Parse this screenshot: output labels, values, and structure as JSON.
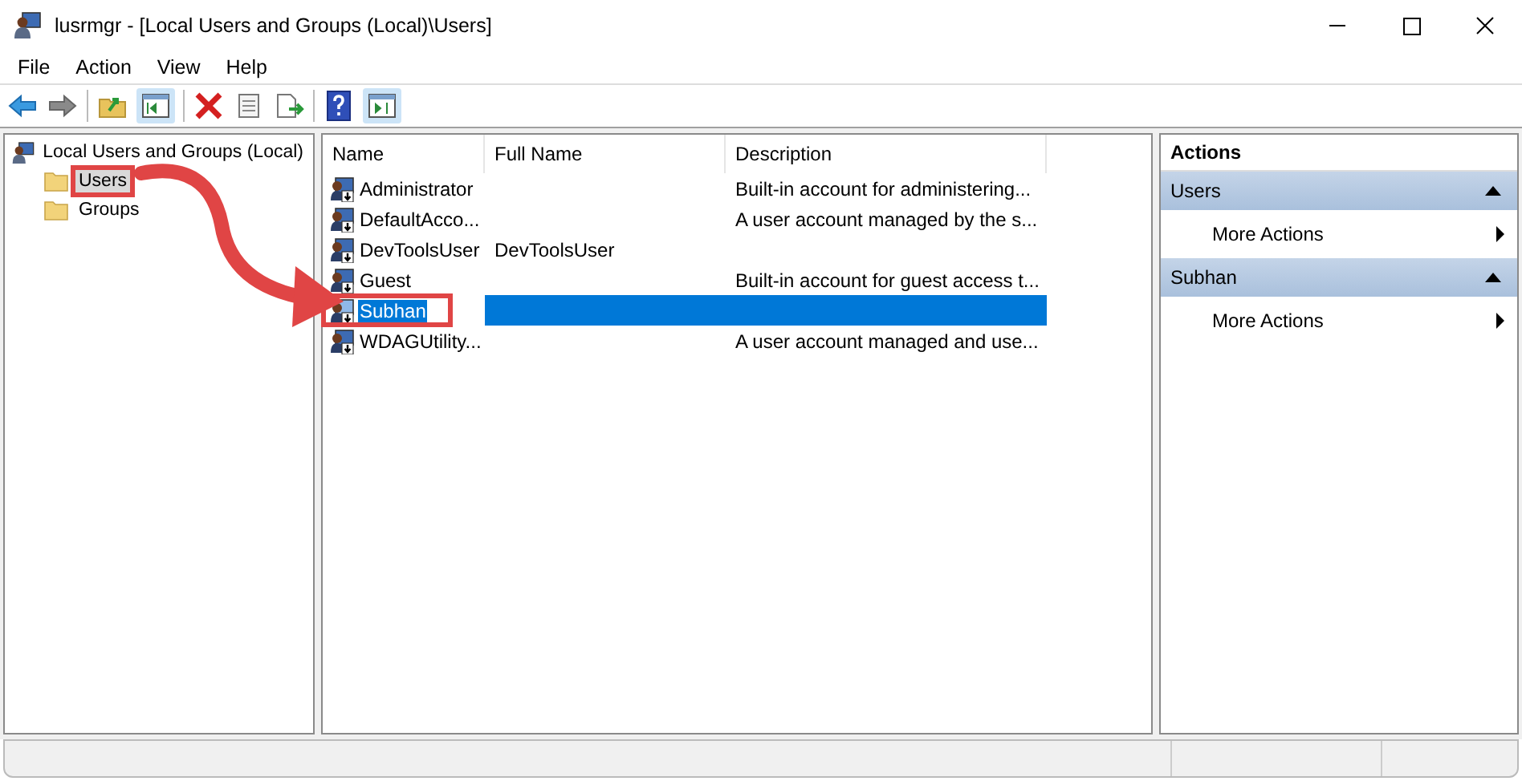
{
  "window": {
    "title": "lusrmgr - [Local Users and Groups (Local)\\Users]"
  },
  "menu": [
    "File",
    "Action",
    "View",
    "Help"
  ],
  "tree": {
    "label": "Local Users and Groups (Local)",
    "children": [
      {
        "label": "Users",
        "selected": true,
        "highlighted": true
      },
      {
        "label": "Groups",
        "selected": false,
        "highlighted": false
      }
    ]
  },
  "table": {
    "columns": [
      "Name",
      "Full Name",
      "Description"
    ],
    "rows": [
      {
        "name": "Administrator",
        "full_name": "",
        "description": "Built-in account for administering...",
        "selected": false,
        "highlighted": false
      },
      {
        "name": "DefaultAcco...",
        "full_name": "",
        "description": "A user account managed by the s...",
        "selected": false,
        "highlighted": false
      },
      {
        "name": "DevToolsUser",
        "full_name": "DevToolsUser",
        "description": "",
        "selected": false,
        "highlighted": false
      },
      {
        "name": "Guest",
        "full_name": "",
        "description": "Built-in account for guest access t...",
        "selected": false,
        "highlighted": false
      },
      {
        "name": "Subhan",
        "full_name": "",
        "description": "",
        "selected": true,
        "highlighted": true
      },
      {
        "name": "WDAGUtility...",
        "full_name": "",
        "description": "A user account managed and use...",
        "selected": false,
        "highlighted": false
      }
    ]
  },
  "actions": {
    "title": "Actions",
    "sections": [
      {
        "title": "Users",
        "items": [
          "More Actions"
        ]
      },
      {
        "title": "Subhan",
        "items": [
          "More Actions"
        ]
      }
    ]
  }
}
